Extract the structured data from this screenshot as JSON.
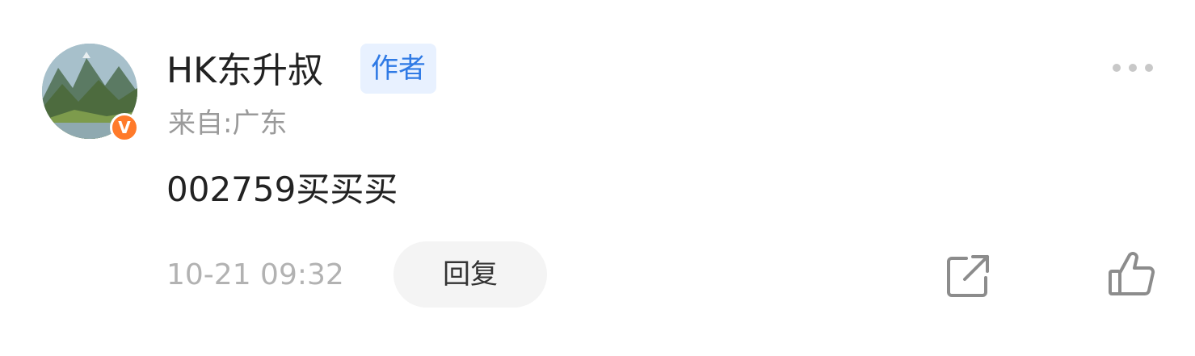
{
  "user": {
    "name": "HK东升叔",
    "tag": "作者",
    "location": "来自:广东",
    "verified_badge": "V",
    "badge_color": "#ff7a2a"
  },
  "comment": {
    "text": "002759买买买",
    "timestamp": "10-21 09:32"
  },
  "actions": {
    "reply_label": "回复",
    "share_icon": "share-icon",
    "like_icon": "thumbs-up-icon",
    "more_icon": "more-icon"
  },
  "colors": {
    "tag_bg": "#e8f1ff",
    "tag_text": "#2f7ae5",
    "secondary_text": "#9a9a9a"
  }
}
